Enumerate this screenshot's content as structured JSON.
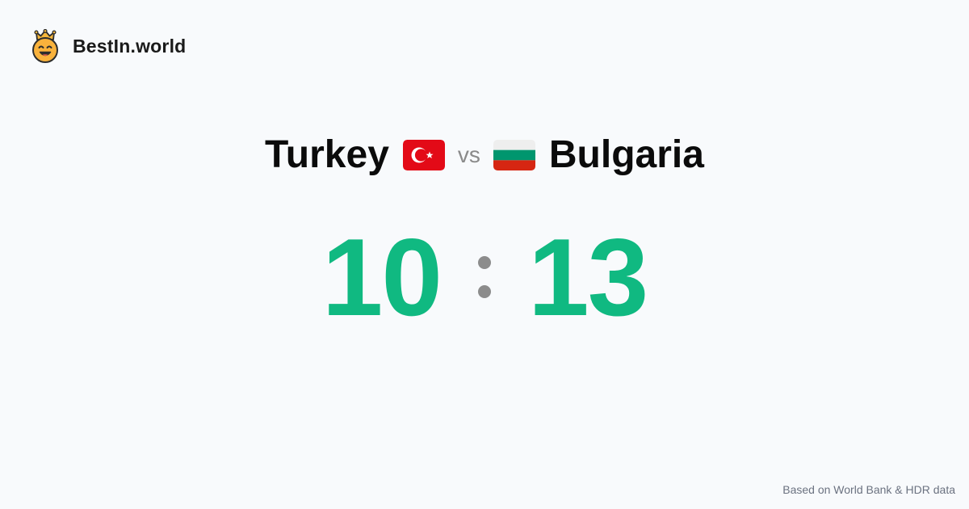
{
  "brand": {
    "name": "BestIn.world",
    "logo_icon": "crowned-smiley-icon"
  },
  "matchup": {
    "country_a": {
      "name": "Turkey",
      "flag_icon": "turkey-flag-icon",
      "flag_colors": [
        "#e30a17",
        "#ffffff"
      ]
    },
    "vs_label": "vs",
    "country_b": {
      "name": "Bulgaria",
      "flag_icon": "bulgaria-flag-icon",
      "flag_colors": [
        "#ffffff",
        "#00966e",
        "#d62612"
      ]
    }
  },
  "score": {
    "a": "10",
    "b": "13",
    "color": "#10b981"
  },
  "footer": {
    "source_note": "Based on World Bank & HDR data"
  }
}
